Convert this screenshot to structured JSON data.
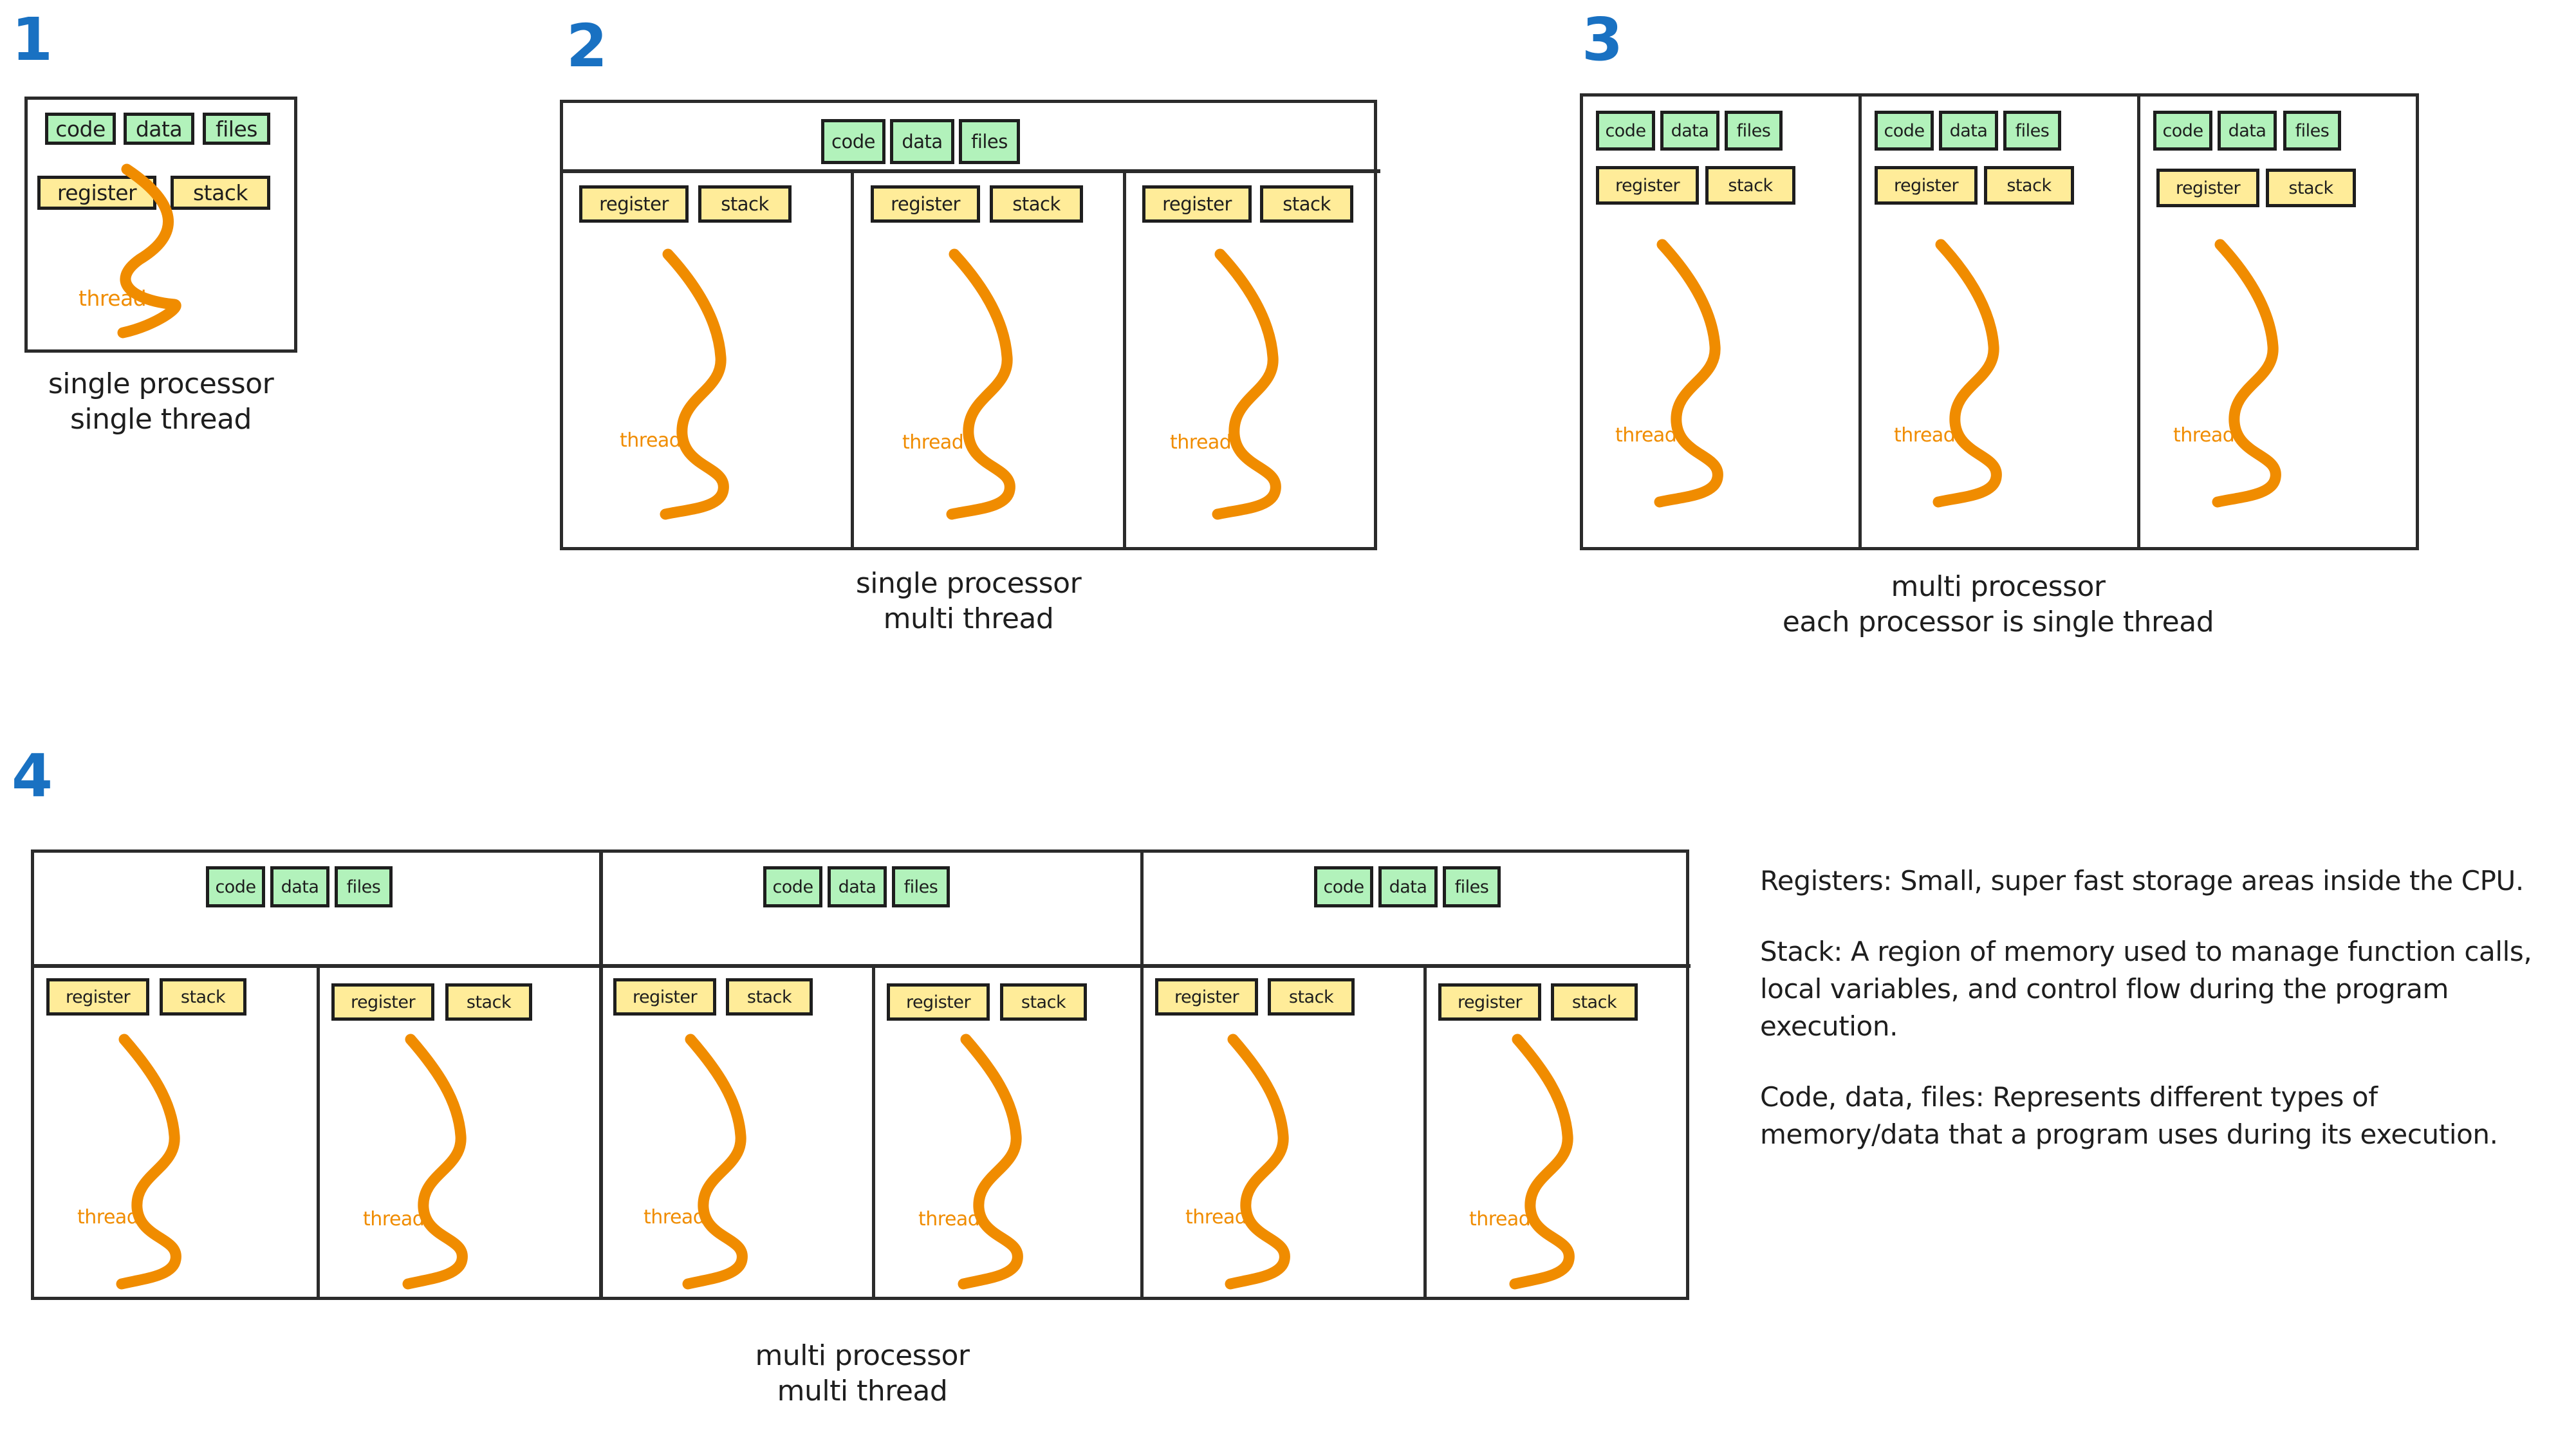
{
  "colors": {
    "number_blue": "#1971c2",
    "memory_green": "#b2f2bb",
    "thread_store_yellow": "#ffec99",
    "thread_orange": "#f08c00",
    "stroke_black": "#1e1e1e",
    "background": "#ffffff"
  },
  "labels": {
    "code": "code",
    "data": "data",
    "files": "files",
    "register": "register",
    "stack": "stack",
    "thread": "thread"
  },
  "panels": [
    {
      "number": "1",
      "caption": "single processor\nsingle thread",
      "processors": 1,
      "threads_per_processor": 1,
      "memory_scope": "per-processor",
      "memory_blocks": [
        "code",
        "data",
        "files"
      ],
      "thread_blocks": [
        "register",
        "stack"
      ]
    },
    {
      "number": "2",
      "caption": "single processor\nmulti thread",
      "processors": 1,
      "threads_per_processor": 3,
      "memory_scope": "shared-across-threads",
      "memory_blocks": [
        "code",
        "data",
        "files"
      ],
      "thread_blocks": [
        "register",
        "stack"
      ]
    },
    {
      "number": "3",
      "caption": "multi processor\neach processor is single thread",
      "processors": 3,
      "threads_per_processor": 1,
      "memory_scope": "per-processor",
      "memory_blocks": [
        "code",
        "data",
        "files"
      ],
      "thread_blocks": [
        "register",
        "stack"
      ]
    },
    {
      "number": "4",
      "caption": "multi processor\nmulti thread",
      "processors": 3,
      "threads_per_processor": 2,
      "memory_scope": "shared-across-threads-within-processor",
      "memory_blocks": [
        "code",
        "data",
        "files"
      ],
      "thread_blocks": [
        "register",
        "stack"
      ]
    }
  ],
  "notes": [
    "Registers: Small, super fast storage areas inside the CPU.",
    "Stack: A region of memory used to manage function calls, local variables, and control flow during the program execution.",
    "Code, data, files: Represents different types of memory/data that a program uses during its execution."
  ]
}
